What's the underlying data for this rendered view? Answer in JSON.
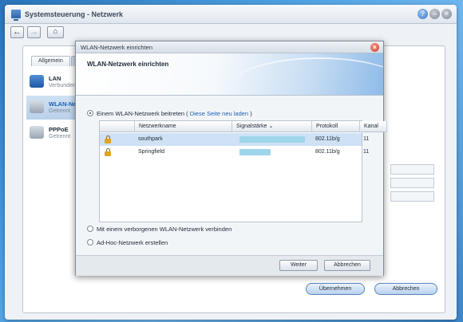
{
  "app": {
    "title": "Systemsteuerung - Netzwerk"
  },
  "toolbar": {
    "back_icon": "arrow-left-icon",
    "forward_icon": "arrow-right-icon",
    "home_icon": "home-icon"
  },
  "background": {
    "tabs": [
      "Allgemein"
    ],
    "connections": [
      {
        "title": "LAN",
        "status": "Verbunden"
      },
      {
        "title": "WLAN-Netz",
        "status": "Getrennt"
      },
      {
        "title": "PPPoE",
        "status": "Getrennt"
      }
    ],
    "apply_label": "Übernehmen",
    "cancel_label": "Abbrechen"
  },
  "modal": {
    "title": "WLAN-Netzwerk einrichten",
    "heading": "WLAN-Netzwerk einrichten",
    "options": {
      "join_prefix": "Einem WLAN-Netzwerk beitreten (",
      "reload_link": "Diese Seite neu laden",
      "join_suffix": ")",
      "hidden": "Mit einem verborgenen WLAN-Netzwerk verbinden",
      "adhoc": "Ad-Hoc-Netzwerk erstellen",
      "selected": "join"
    },
    "table": {
      "headers": [
        "Netzwerkname",
        "Signalstärke",
        "Protokoll",
        "Kanal"
      ],
      "sort_indicator": "⌄",
      "rows": [
        {
          "name": "southpark",
          "signal": 0.97,
          "protocol": "802.11b/g",
          "channel": "11",
          "locked": true
        },
        {
          "name": "Springfield",
          "signal": 0.46,
          "protocol": "802.11b/g",
          "channel": "11",
          "locked": true
        }
      ]
    },
    "next_label": "Weiter",
    "cancel_label": "Abbrechen"
  },
  "colors": {
    "accent": "#1f5fb4",
    "selection": "#cfe1f5",
    "signal": "#9fd5ea"
  }
}
